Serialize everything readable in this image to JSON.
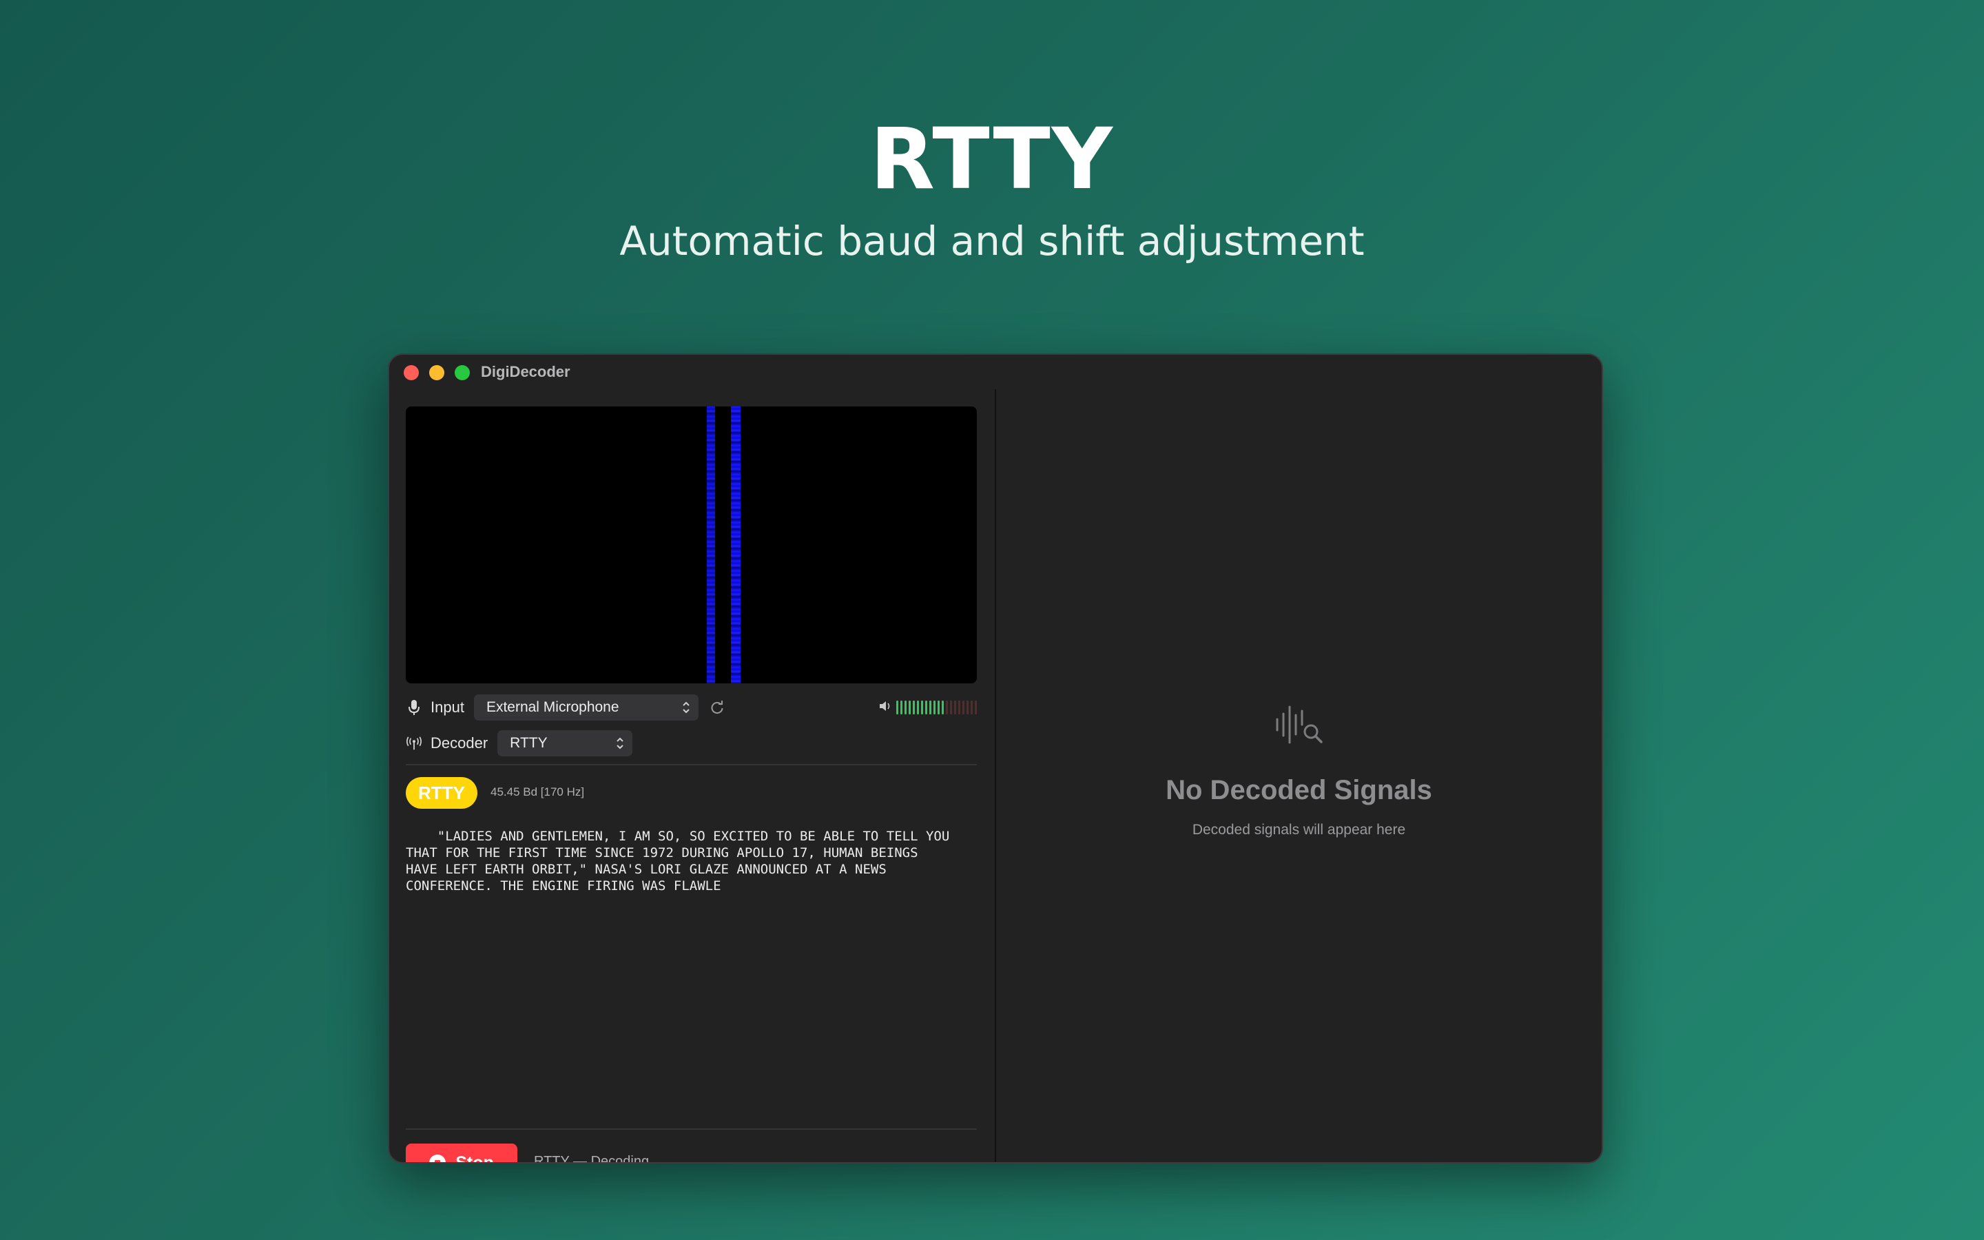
{
  "hero": {
    "title": "RTTY",
    "subtitle": "Automatic baud and shift adjustment"
  },
  "window": {
    "title": "DigiDecoder"
  },
  "controls": {
    "input_label": "Input",
    "input_value": "External Microphone",
    "decoder_label": "Decoder",
    "decoder_value": "RTTY",
    "input_level_fraction": 0.6
  },
  "decode": {
    "badge": "RTTY",
    "info": "45.45 Bd [170 Hz]",
    "text": "    \"LADIES AND GENTLEMEN, I AM SO, SO EXCITED TO BE ABLE TO TELL YOU\nTHAT FOR THE FIRST TIME SINCE 1972 DURING APOLLO 17, HUMAN BEINGS\nHAVE LEFT EARTH ORBIT,\" NASA'S LORI GLAZE ANNOUNCED AT A NEWS\nCONFERENCE. THE ENGINE FIRING WAS FLAWLE"
  },
  "footer": {
    "stop_label": "Stop",
    "status": "RTTY — Decoding..."
  },
  "empty_state": {
    "title": "No Decoded Signals",
    "subtitle": "Decoded signals will appear here"
  },
  "colors": {
    "badge": "#ffd60a",
    "stop": "#ff3b43",
    "meter_active": "#34c759",
    "meter_inactive": "#5a2a2a"
  }
}
